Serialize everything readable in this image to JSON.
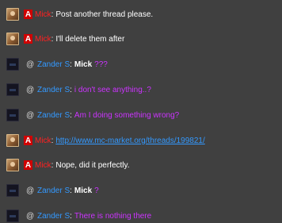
{
  "messages": [
    {
      "user": "Mick",
      "role": "A",
      "sep": ":",
      "text": "Post another thread please."
    },
    {
      "user": "Mick",
      "role": "A",
      "sep": ":",
      "text": "I'll delete them after"
    },
    {
      "user": "Zander S",
      "role": "@",
      "sep": ":",
      "mention": "Mick",
      "text": "???"
    },
    {
      "user": "Zander S",
      "role": "@",
      "sep": ":",
      "text": "i don't see anything..?"
    },
    {
      "user": "Zander S",
      "role": "@",
      "sep": ":",
      "text": "Am I doing something wrong?"
    },
    {
      "user": "Mick",
      "role": "A",
      "sep": ":",
      "text": "http://www.mc-market.org/threads/199821/"
    },
    {
      "user": "Mick",
      "role": "A",
      "sep": ":",
      "text": "Nope, did it perfectly."
    },
    {
      "user": "Zander S",
      "role": "@",
      "sep": ":",
      "mention": "Mick",
      "text": "?"
    },
    {
      "user": "Zander S",
      "role": "@",
      "sep": ":",
      "text": "There is nothing there"
    }
  ],
  "colors": {
    "background": "#404040",
    "admin_name": "#ff2020",
    "user_name": "#3399ff",
    "message_purple": "#cc33ff",
    "link": "#3399ff",
    "admin_badge": "#d00000"
  },
  "icons": {
    "mick_avatar": "avatar-image",
    "zander_avatar": "avatar-image"
  }
}
